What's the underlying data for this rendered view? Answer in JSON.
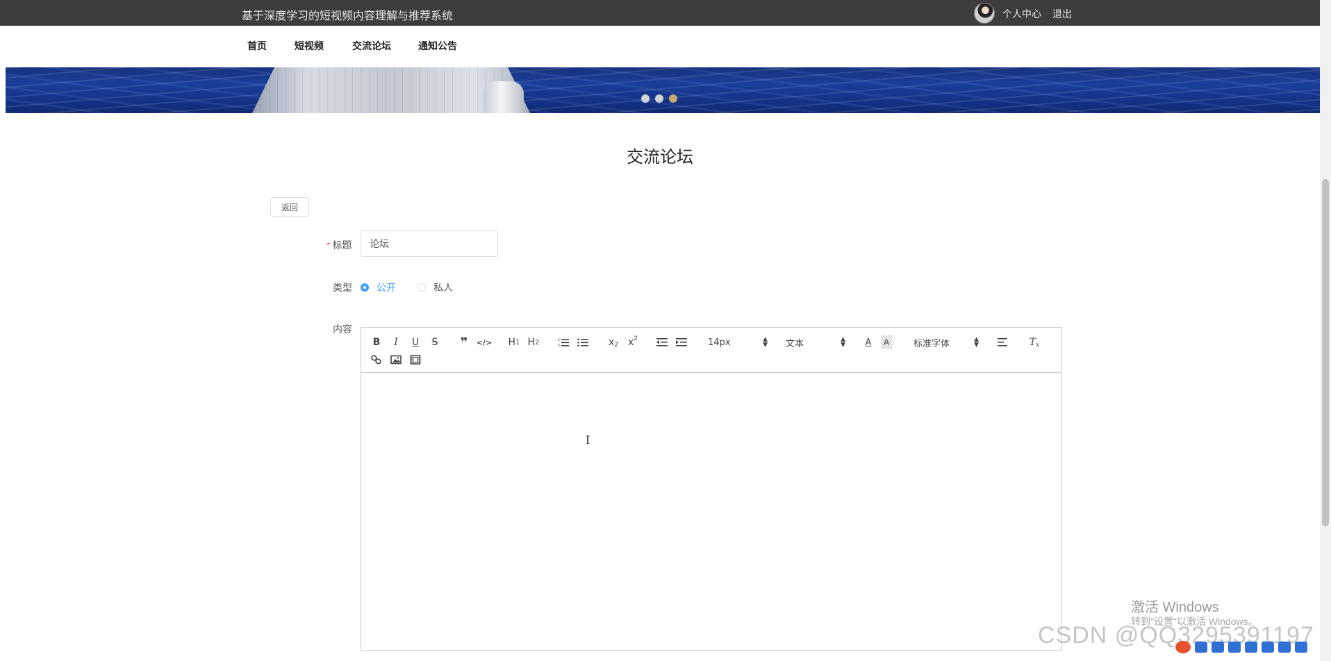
{
  "header": {
    "site_title": "基于深度学习的短视频内容理解与推荐系统",
    "user_center": "个人中心",
    "logout": "退出"
  },
  "nav": {
    "items": [
      {
        "label": "首页"
      },
      {
        "label": "短视频"
      },
      {
        "label": "交流论坛"
      },
      {
        "label": "通知公告"
      }
    ]
  },
  "banner": {
    "dots_count": 3,
    "active_dot": 3
  },
  "page": {
    "title": "交流论坛",
    "back_button": "返回"
  },
  "form": {
    "title_label": "标题",
    "title_value": "论坛",
    "type_label": "类型",
    "type_options": [
      {
        "label": "公开",
        "checked": true
      },
      {
        "label": "私人",
        "checked": false
      }
    ],
    "content_label": "内容"
  },
  "editor": {
    "size_value": "14px",
    "header_value": "文本",
    "font_value": "标准字体",
    "buttons": [
      "bold-icon",
      "italic-icon",
      "underline-icon",
      "strike-icon",
      "blockquote-icon",
      "code-block-icon",
      "h1-icon",
      "h2-icon",
      "ordered-list-icon",
      "bullet-list-icon",
      "subscript-icon",
      "superscript-icon",
      "outdent-icon",
      "indent-icon",
      "font-color-icon",
      "background-color-icon",
      "align-icon",
      "clear-format-icon",
      "link-icon",
      "image-icon",
      "video-icon"
    ]
  },
  "watermarks": {
    "windows_line1": "激活 Windows",
    "windows_line2": "转到\"设置\"以激活 Windows。",
    "csdn": "CSDN @QQ3295391197"
  },
  "colors": {
    "topbar": "#3d3d3d",
    "accent": "#409eff",
    "required": "#f56c6c",
    "active_dot": "#c8a86e"
  }
}
